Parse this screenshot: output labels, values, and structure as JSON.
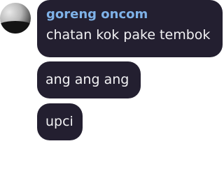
{
  "chat": {
    "messages": [
      {
        "sender": "goreng oncom",
        "text": "chatan kok pake tembok"
      },
      {
        "text": "ang ang ang"
      },
      {
        "text": "upci"
      }
    ]
  },
  "colors": {
    "bubble_bg": "#231f30",
    "sender_name": "#7fb2e8",
    "message_text": "#f2f2f4"
  }
}
